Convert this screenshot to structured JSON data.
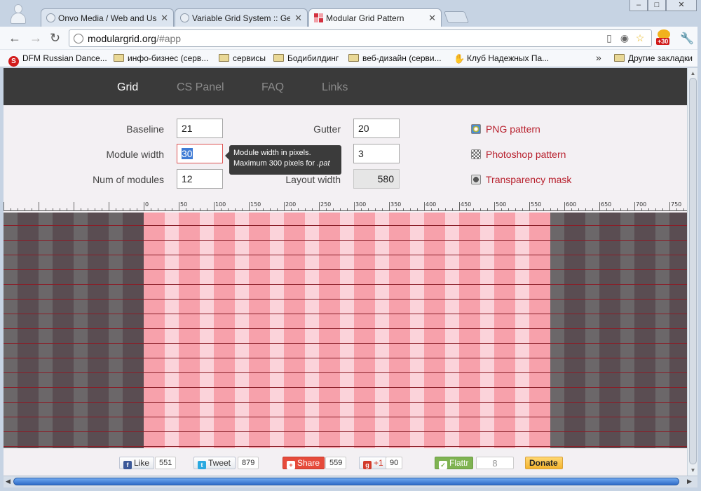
{
  "browser": {
    "tabs": [
      {
        "title": "Onvo Media / Web and Use",
        "active": false
      },
      {
        "title": "Variable Grid System :: Ger",
        "active": false
      },
      {
        "title": "Modular Grid Pattern",
        "active": true
      }
    ],
    "window_buttons": [
      "–",
      "□",
      "✕"
    ],
    "url_host": "modulargrid.org",
    "url_path": "/#app",
    "extension_badge": "+30",
    "bookmarks": [
      {
        "label": "DFM Russian Dance...",
        "icon": "s-logo-icon"
      },
      {
        "label": "инфо-бизнес (серв...",
        "icon": "folder-icon"
      },
      {
        "label": "сервисы",
        "icon": "folder-icon"
      },
      {
        "label": "Бодибилдинг",
        "icon": "folder-icon"
      },
      {
        "label": "веб-дизайн (серви...",
        "icon": "folder-icon"
      },
      {
        "label": "Клуб Надежных Па...",
        "icon": "handshake-icon"
      }
    ],
    "other_bookmarks": "Другие закладки",
    "overflow": "»"
  },
  "site": {
    "nav": [
      "Grid",
      "CS Panel",
      "FAQ",
      "Links"
    ],
    "active_nav": "Grid",
    "fields": {
      "baseline": {
        "label": "Baseline",
        "value": "21"
      },
      "module_width": {
        "label": "Module width",
        "value": "30"
      },
      "num_modules": {
        "label": "Num of modules",
        "value": "12"
      },
      "gutter": {
        "label": "Gutter",
        "value": "20"
      },
      "module_height": {
        "label": "Module height",
        "visible_label": "height",
        "value": "3"
      },
      "layout_width": {
        "label": "Layout width",
        "value": "580"
      }
    },
    "tooltip": {
      "line1": "Module width in pixels.",
      "line2": "Maximum 300 pixels for ",
      "line2_em": ".pat"
    },
    "downloads": [
      "PNG pattern",
      "Photoshop pattern",
      "Transparency mask"
    ],
    "ruler_labels": [
      "0",
      "50",
      "100",
      "150",
      "200",
      "250",
      "300",
      "350",
      "400",
      "450",
      "500",
      "550",
      "600",
      "650",
      "700",
      "750"
    ],
    "social": {
      "like": {
        "label": "Like",
        "count": "551"
      },
      "tweet": {
        "label": "Tweet",
        "count": "879"
      },
      "share": {
        "label": "Share",
        "count": "559"
      },
      "plusone": {
        "label": "+1",
        "count": "90"
      },
      "flattr": {
        "label": "Flattr",
        "count": "8"
      },
      "donate": {
        "label": "Donate"
      }
    }
  },
  "colors": {
    "nav_bg": "#3a3a3a",
    "module_pink": "#f7a1ab",
    "gutter_pink": "#fbd3da",
    "outside_dark": "#5a4d52",
    "outside_light": "#6b6769",
    "baseline_red": "#8a1e28",
    "download_red": "#b8212e"
  }
}
